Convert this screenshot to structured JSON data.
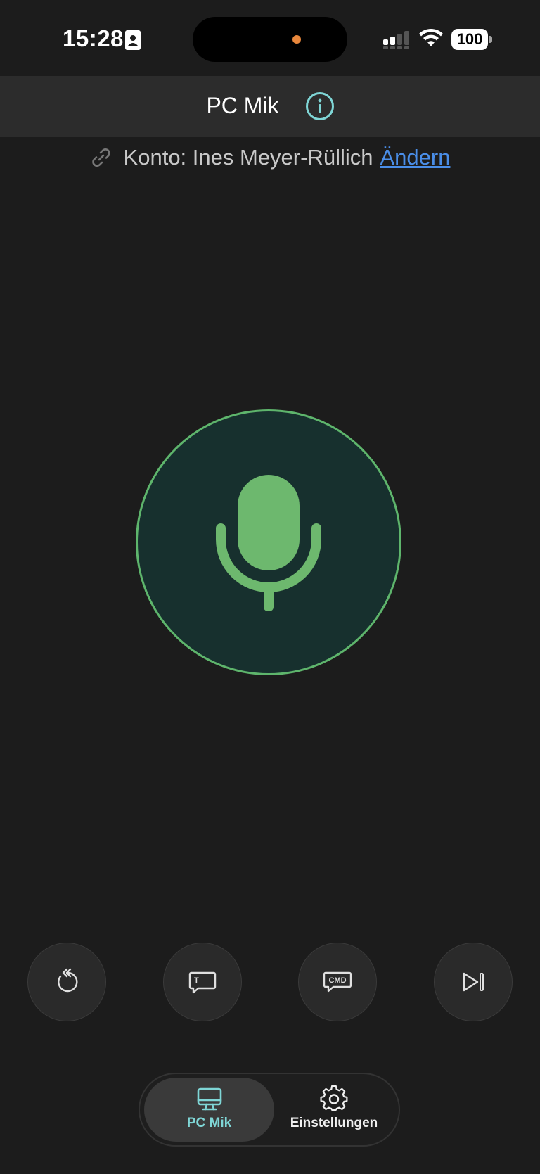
{
  "status_bar": {
    "time": "15:28",
    "battery": "100"
  },
  "header": {
    "title": "PC Mik"
  },
  "account": {
    "label": "Konto: Ines Meyer-Rüllich",
    "change_link": "Ändern"
  },
  "actions": [
    {
      "icon": "undo-icon"
    },
    {
      "icon": "text-message-icon"
    },
    {
      "icon": "command-message-icon",
      "badge": "CMD"
    },
    {
      "icon": "skip-next-icon"
    }
  ],
  "tabs": [
    {
      "label": "PC Mik",
      "icon": "monitor-icon",
      "active": true
    },
    {
      "label": "Einstellungen",
      "icon": "gear-icon",
      "active": false
    }
  ],
  "colors": {
    "background": "#1c1c1c",
    "header": "#2c2c2c",
    "accent_teal": "#7fd6d6",
    "mic_green": "#5eb56c",
    "link_blue": "#4a8ee8"
  }
}
